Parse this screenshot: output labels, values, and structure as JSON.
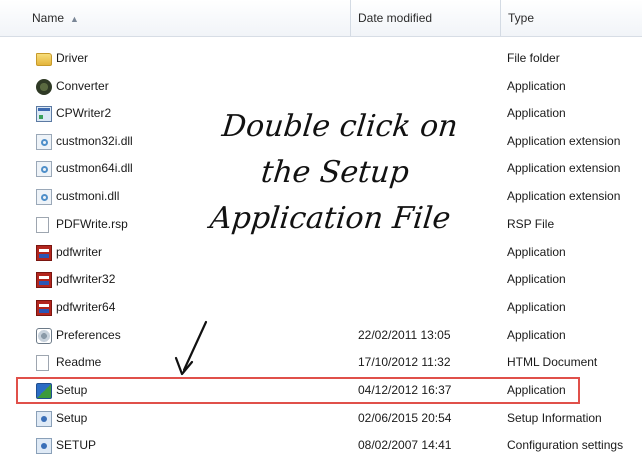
{
  "columns": {
    "name": "Name",
    "date": "Date modified",
    "type": "Type"
  },
  "files": [
    {
      "name": "Driver",
      "date": "",
      "type": "File folder",
      "icon": "folder-icon"
    },
    {
      "name": "Converter",
      "date": "",
      "type": "Application",
      "icon": "gear-app-icon"
    },
    {
      "name": "CPWriter2",
      "date": "",
      "type": "Application",
      "icon": "window-app-icon"
    },
    {
      "name": "custmon32i.dll",
      "date": "",
      "type": "Application extension",
      "icon": "dll-icon"
    },
    {
      "name": "custmon64i.dll",
      "date": "",
      "type": "Application extension",
      "icon": "dll-icon"
    },
    {
      "name": "custmoni.dll",
      "date": "",
      "type": "Application extension",
      "icon": "dll-icon"
    },
    {
      "name": "PDFWrite.rsp",
      "date": "",
      "type": "RSP File",
      "icon": "document-icon"
    },
    {
      "name": "pdfwriter",
      "date": "",
      "type": "Application",
      "icon": "pdf-app-icon"
    },
    {
      "name": "pdfwriter32",
      "date": "",
      "type": "Application",
      "icon": "pdf-app-icon"
    },
    {
      "name": "pdfwriter64",
      "date": "",
      "type": "Application",
      "icon": "pdf-app-icon"
    },
    {
      "name": "Preferences",
      "date": "22/02/2011 13:05",
      "type": "Application",
      "icon": "preferences-icon"
    },
    {
      "name": "Readme",
      "date": "17/10/2012 11:32",
      "type": "HTML Document",
      "icon": "document-icon"
    },
    {
      "name": "Setup",
      "date": "04/12/2012 16:37",
      "type": "Application",
      "icon": "setup-app-icon"
    },
    {
      "name": "Setup",
      "date": "02/06/2015 20:54",
      "type": "Setup Information",
      "icon": "setup-info-icon"
    },
    {
      "name": "SETUP",
      "date": "08/02/2007 14:41",
      "type": "Configuration settings",
      "icon": "config-settings-icon"
    }
  ],
  "annotation": {
    "line1": "Double click on",
    "line2": "the Setup",
    "line3": "Application File"
  },
  "colors": {
    "highlight": "#e0504a",
    "header_bg": "#f1f4f8"
  }
}
